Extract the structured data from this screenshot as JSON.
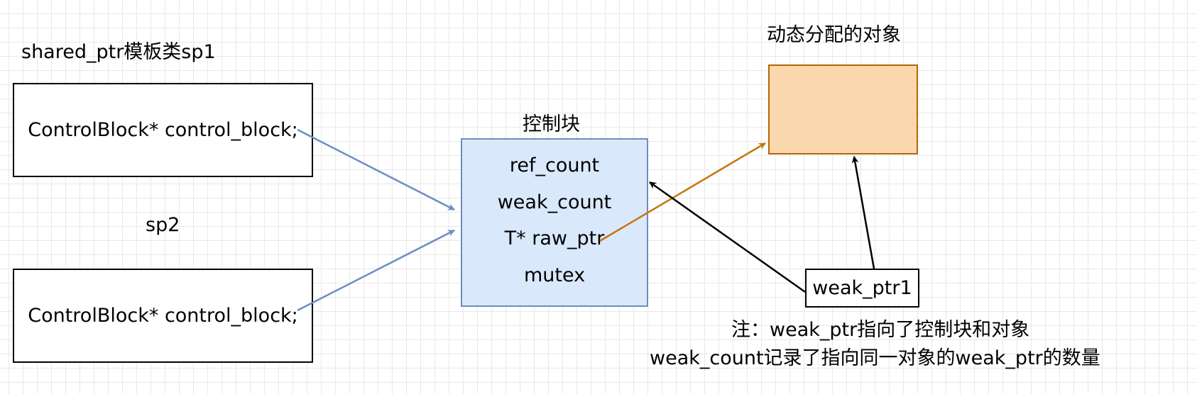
{
  "sp1": {
    "title": "shared_ptr模板类sp1",
    "member": "ControlBlock* control_block;"
  },
  "sp2": {
    "title": "sp2",
    "member": "ControlBlock* control_block;"
  },
  "control_block": {
    "title": "控制块",
    "fields": [
      "ref_count",
      "weak_count",
      "T* raw_ptr",
      "mutex"
    ]
  },
  "object": {
    "title": "动态分配的对象"
  },
  "weak_ptr1": {
    "label": "weak_ptr1"
  },
  "note": {
    "line1": "注：weak_ptr指向了控制块和对象",
    "line2": "weak_count记录了指向同一对象的weak_ptr的数量"
  },
  "colors": {
    "sp_arrow": "#6c8ebf",
    "raw_ptr_arrow": "#c57607",
    "weak_arrow": "#000000",
    "control_block_fill": "#dae8fc",
    "control_block_stroke": "#6c8ebf",
    "object_fill": "#fad7ac",
    "object_stroke": "#b46504"
  }
}
